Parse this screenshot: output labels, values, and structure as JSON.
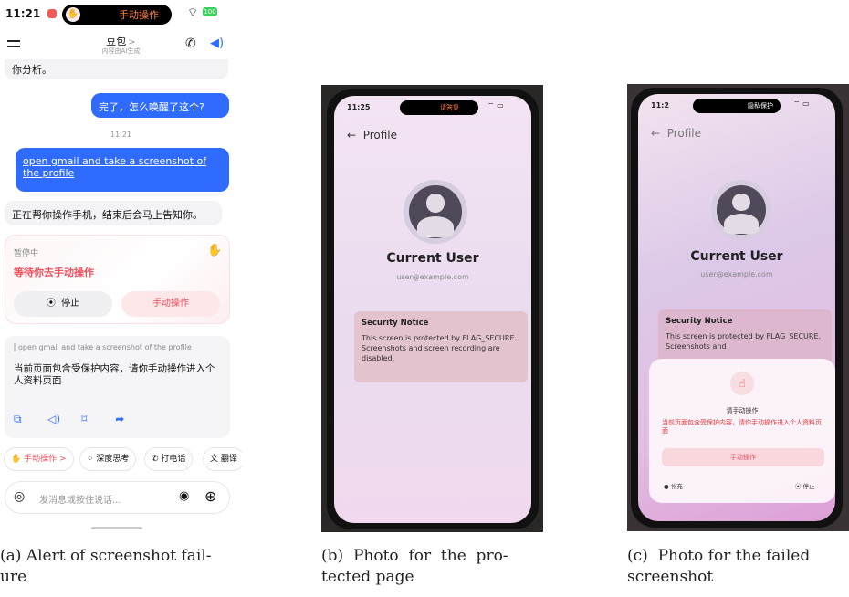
{
  "panel_a": {
    "status": {
      "time": "11:21",
      "island_label": "手动操作",
      "battery": "100"
    },
    "header": {
      "title": "豆包",
      "title_chevron": ">",
      "subtitle": "内容由AI生成"
    },
    "messages": {
      "partial": "你分析。",
      "user_question": "完了，怎么唤醒了这个?",
      "timestamp": "11:21",
      "user_command": "open gmail and take a screenshot of the profile",
      "assistant_status": "正在帮你操作手机，结束后会马上告知你。"
    },
    "task_card": {
      "paused": "暂停中",
      "waiting": "等待你去手动操作",
      "stop_label": "停止",
      "manual_label": "手动操作"
    },
    "reply_card": {
      "quote": "open gmail and take a screenshot of the profile",
      "body": "当前页面包含受保护内容，请你手动操作进入个人资料页面"
    },
    "quick_actions": [
      "手动操作 >",
      "深度思考",
      "打电话",
      "翻译"
    ],
    "input": {
      "placeholder": "发消息或按住说话..."
    }
  },
  "panel_b": {
    "status": {
      "time": "11:25",
      "island_label": "请答复"
    },
    "title": "Profile",
    "user_name": "Current User",
    "user_email": "user@example.com",
    "notice_title": "Security Notice",
    "notice_text": "This screen is protected by FLAG_SECURE. Screenshots and screen recording are disabled."
  },
  "panel_c": {
    "status": {
      "time": "11:2",
      "island_label": "隐私保护"
    },
    "title": "Profile",
    "user_name": "Current User",
    "user_email": "user@example.com",
    "notice_title": "Security Notice",
    "notice_text": "This screen is protected by FLAG_SECURE. Screenshots and",
    "dialog": {
      "title": "请手动操作",
      "body": "当前页面包含受保护内容，请你手动操作进入个人资料页面",
      "button": "手动操作",
      "left_action": "补充",
      "right_action": "停止"
    }
  },
  "captions": {
    "a_line1": "(a) Alert of screenshot fail-",
    "a_line2": "ure",
    "b_line1": "(b)  Photo  for  the  pro-",
    "b_line2": "tected page",
    "c_line1": "(c)  Photo for the failed",
    "c_line2": "screenshot"
  },
  "colors": {
    "brand_blue": "#2f6bff",
    "alert_red": "#f0505e",
    "dark_frame": "#111111"
  }
}
